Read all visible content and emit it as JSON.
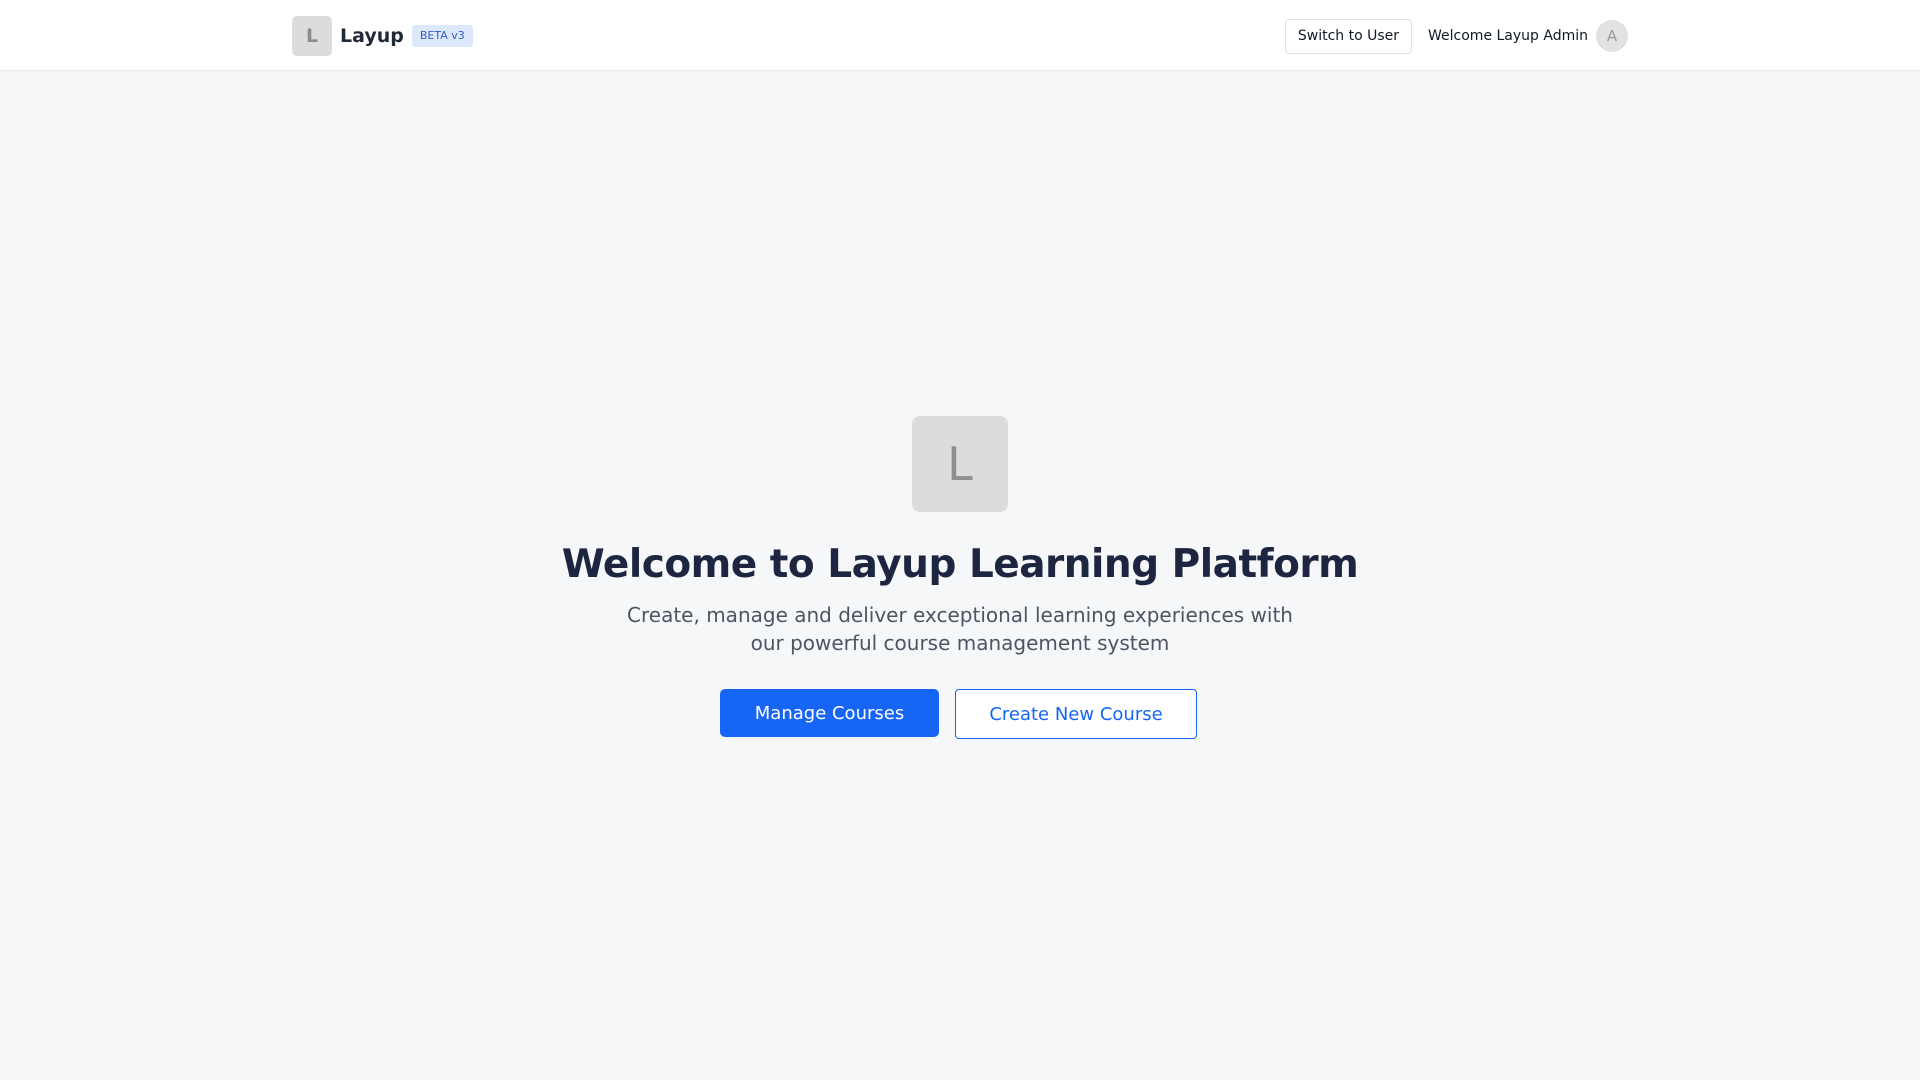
{
  "header": {
    "logo_letter": "L",
    "brand_name": "Layup",
    "badge": "BETA v3",
    "switch_button": "Switch to User",
    "welcome_text": "Welcome Layup Admin",
    "avatar_letter": "A"
  },
  "hero": {
    "logo_letter": "L",
    "title": "Welcome to Layup Learning Platform",
    "subtitle": "Create, manage and deliver exceptional learning experiences with our powerful course management system",
    "primary_button": "Manage Courses",
    "secondary_button": "Create New Course"
  },
  "colors": {
    "accent": "#1665f5",
    "page_background": "#f6f7f9",
    "title": "#1e2540"
  }
}
